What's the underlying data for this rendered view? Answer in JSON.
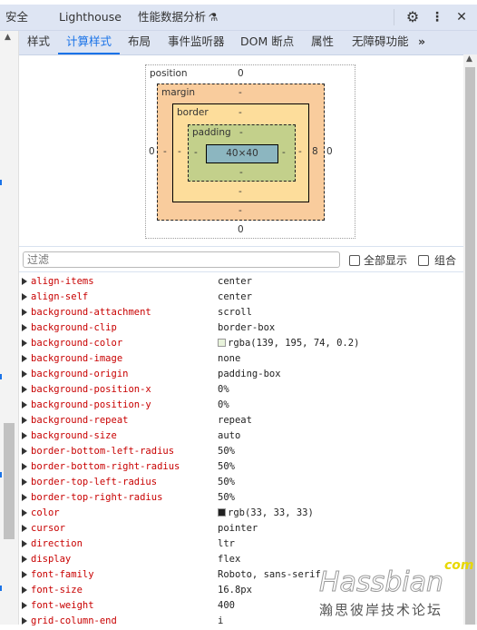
{
  "top_tabs": [
    {
      "label": "安全"
    },
    {
      "label": "Lighthouse"
    },
    {
      "label": "性能数据分析"
    }
  ],
  "top_icons": {
    "flask": "⚗",
    "settings": "⚙",
    "more": "⋮",
    "close": "✕"
  },
  "sub_tabs": [
    {
      "label": "样式",
      "active": false
    },
    {
      "label": "计算样式",
      "active": true
    },
    {
      "label": "布局",
      "active": false
    },
    {
      "label": "事件监听器",
      "active": false
    },
    {
      "label": "DOM 断点",
      "active": false
    },
    {
      "label": "属性",
      "active": false
    },
    {
      "label": "无障碍功能",
      "active": false
    }
  ],
  "sub_tabs_overflow": "»",
  "box_model": {
    "position_label": "position",
    "position_top": "0",
    "position_left": "0",
    "position_right": "0",
    "position_bottom": "0",
    "margin_label": "margin",
    "margin_top": "-",
    "margin_left": "-",
    "margin_right": "8",
    "margin_bottom": "-",
    "border_label": "border",
    "border_top": "-",
    "border_left": "-",
    "border_right": "-",
    "border_bottom": "-",
    "padding_label": "padding",
    "padding_top": "-",
    "padding_left": "-",
    "padding_right": "-",
    "padding_bottom": "-",
    "content_size": "40×40"
  },
  "filter": {
    "placeholder": "过滤",
    "show_all_label": "全部显示",
    "group_label": "组合"
  },
  "properties": [
    {
      "name": "align-items",
      "value": "center"
    },
    {
      "name": "align-self",
      "value": "center"
    },
    {
      "name": "background-attachment",
      "value": "scroll"
    },
    {
      "name": "background-clip",
      "value": "border-box"
    },
    {
      "name": "background-color",
      "value": "rgba(139, 195, 74, 0.2)",
      "swatch": "#e8f3db"
    },
    {
      "name": "background-image",
      "value": "none"
    },
    {
      "name": "background-origin",
      "value": "padding-box"
    },
    {
      "name": "background-position-x",
      "value": "0%"
    },
    {
      "name": "background-position-y",
      "value": "0%"
    },
    {
      "name": "background-repeat",
      "value": "repeat"
    },
    {
      "name": "background-size",
      "value": "auto"
    },
    {
      "name": "border-bottom-left-radius",
      "value": "50%"
    },
    {
      "name": "border-bottom-right-radius",
      "value": "50%"
    },
    {
      "name": "border-top-left-radius",
      "value": "50%"
    },
    {
      "name": "border-top-right-radius",
      "value": "50%"
    },
    {
      "name": "color",
      "value": "rgb(33, 33, 33)",
      "swatch": "#212121"
    },
    {
      "name": "cursor",
      "value": "pointer"
    },
    {
      "name": "direction",
      "value": "ltr"
    },
    {
      "name": "display",
      "value": "flex"
    },
    {
      "name": "font-family",
      "value": "Roboto, sans-serif"
    },
    {
      "name": "font-size",
      "value": "16.8px"
    },
    {
      "name": "font-weight",
      "value": "400"
    },
    {
      "name": "grid-column-end",
      "value": "i"
    }
  ],
  "watermark": {
    "com": "com",
    "brand": "Hassbian",
    "subtitle": "瀚思彼岸技术论坛"
  },
  "colors": {
    "accent": "#1a73e8",
    "prop_name": "#c80000",
    "margin_bg": "#f9cc9d",
    "border_bg": "#fddd9b",
    "padding_bg": "#c3d08b",
    "content_bg": "#8cb6c0"
  }
}
